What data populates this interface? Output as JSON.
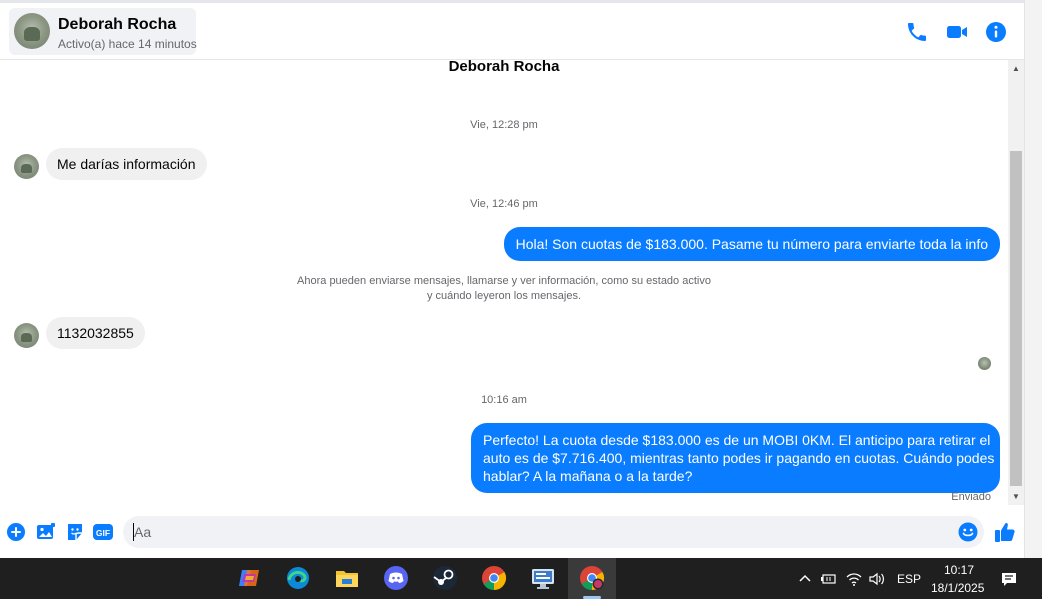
{
  "header": {
    "contact_name": "Deborah Rocha",
    "status": "Activo(a) hace 14 minutos",
    "icons": [
      "phone-icon",
      "video-camera-icon",
      "info-icon"
    ],
    "accent_color": "#0a7cff"
  },
  "chat": {
    "title": "Deborah Rocha",
    "timestamp_1": "Vie, 12:28 pm",
    "message_1": "Me darías información",
    "timestamp_2": "Vie, 12:46 pm",
    "message_2": "Hola! Son cuotas de $183.000. Pasame tu número para enviarte toda la info",
    "notice_line_1": "Ahora pueden enviarse mensajes, llamarse y ver información, como su estado activo",
    "notice_line_2": "y cuándo leyeron los mensajes.",
    "message_3": "1132032855",
    "timestamp_3": "10:16 am",
    "message_4_line_1": "Perfecto! La cuota desde $183.000 es de un MOBI 0KM. El anticipo para retirar el",
    "message_4_line_2": "auto es de $7.716.400, mientras tanto podes ir pagando en cuotas. Cuándo podes",
    "message_4_line_3": "hablar? A la mañana o a la tarde?",
    "sent_label": "Enviado"
  },
  "composer": {
    "placeholder": "Aa",
    "icons": [
      "plus-icon",
      "image-icon",
      "sticker-icon",
      "gif-icon",
      "emoji-icon",
      "thumbs-up-icon"
    ],
    "gif_label": "GIF"
  },
  "taskbar": {
    "apps": [
      "copilot-icon",
      "edge-icon",
      "file-explorer-icon",
      "discord-icon",
      "steam-icon",
      "chrome-icon",
      "remote-desktop-icon",
      "chrome-profile-icon"
    ],
    "language": "ESP",
    "time": "10:17",
    "date": "18/1/2025"
  }
}
